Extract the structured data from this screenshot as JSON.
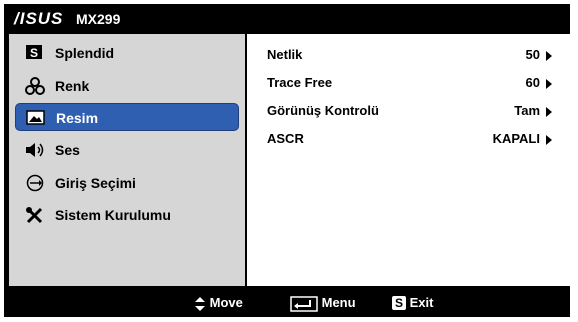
{
  "header": {
    "brand": "/ISUS",
    "model": "MX299"
  },
  "menu": {
    "items": [
      {
        "label": "Splendid",
        "icon": "splendid-s-icon"
      },
      {
        "label": "Renk",
        "icon": "color-dots-icon"
      },
      {
        "label": "Resim",
        "icon": "image-icon"
      },
      {
        "label": "Ses",
        "icon": "speaker-icon"
      },
      {
        "label": "Giriş Seçimi",
        "icon": "input-select-icon"
      },
      {
        "label": "Sistem Kurulumu",
        "icon": "tools-icon"
      }
    ],
    "selected": "Resim"
  },
  "settings": [
    {
      "name": "Netlik",
      "value": "50"
    },
    {
      "name": "Trace Free",
      "value": "60"
    },
    {
      "name": "Görünüş Kontrolü",
      "value": "Tam"
    },
    {
      "name": "ASCR",
      "value": "KAPALI"
    }
  ],
  "footer": {
    "move": "Move",
    "menu": "Menu",
    "exit": "Exit",
    "exit_key": "S"
  },
  "colors": {
    "selected_bg": "#2e5fb0",
    "panel_bg": "#d6d6d6",
    "bar_bg": "#000000"
  }
}
